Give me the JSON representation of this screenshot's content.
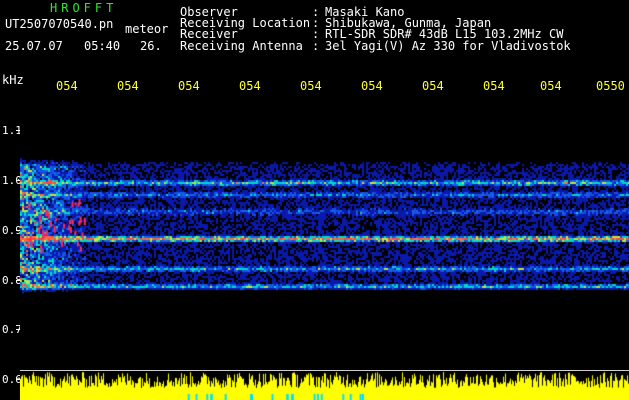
{
  "header": {
    "app_title": "HROFFT",
    "file_name": "UT2507070540.pn",
    "file_tag": "meteor",
    "date": "25.07.07",
    "time": "05:40",
    "extra": "26."
  },
  "info": [
    {
      "label": "Observer",
      "sep": ":",
      "value": "Masaki Kano"
    },
    {
      "label": "Receiving Location",
      "sep": ":",
      "value": "Shibukawa, Gunma, Japan"
    },
    {
      "label": "Receiver",
      "sep": ":",
      "value": "RTL-SDR SDR# 43dB L15 103.2MHz CW"
    },
    {
      "label": "Receiving Antenna",
      "sep": ":",
      "value": "3el Yagi(V) Az 330 for Vladivostok"
    }
  ],
  "axis": {
    "unit": "kHz",
    "time_ticks": [
      "054",
      "054",
      "054",
      "054",
      "054",
      "054",
      "054",
      "054",
      "054",
      "0550"
    ],
    "freq_ticks": [
      "1.1",
      "1.0",
      "0.9",
      "0.8",
      "0.7",
      "0.6"
    ]
  },
  "colors": {
    "background": "#000000",
    "title": "#2ee62e",
    "time_ticks": "#ffff33",
    "signal_low": "#0a1a8c",
    "signal_mid": "#00c8e6",
    "signal_high": "#ff3333",
    "noise_floor": "#ffff00"
  }
}
